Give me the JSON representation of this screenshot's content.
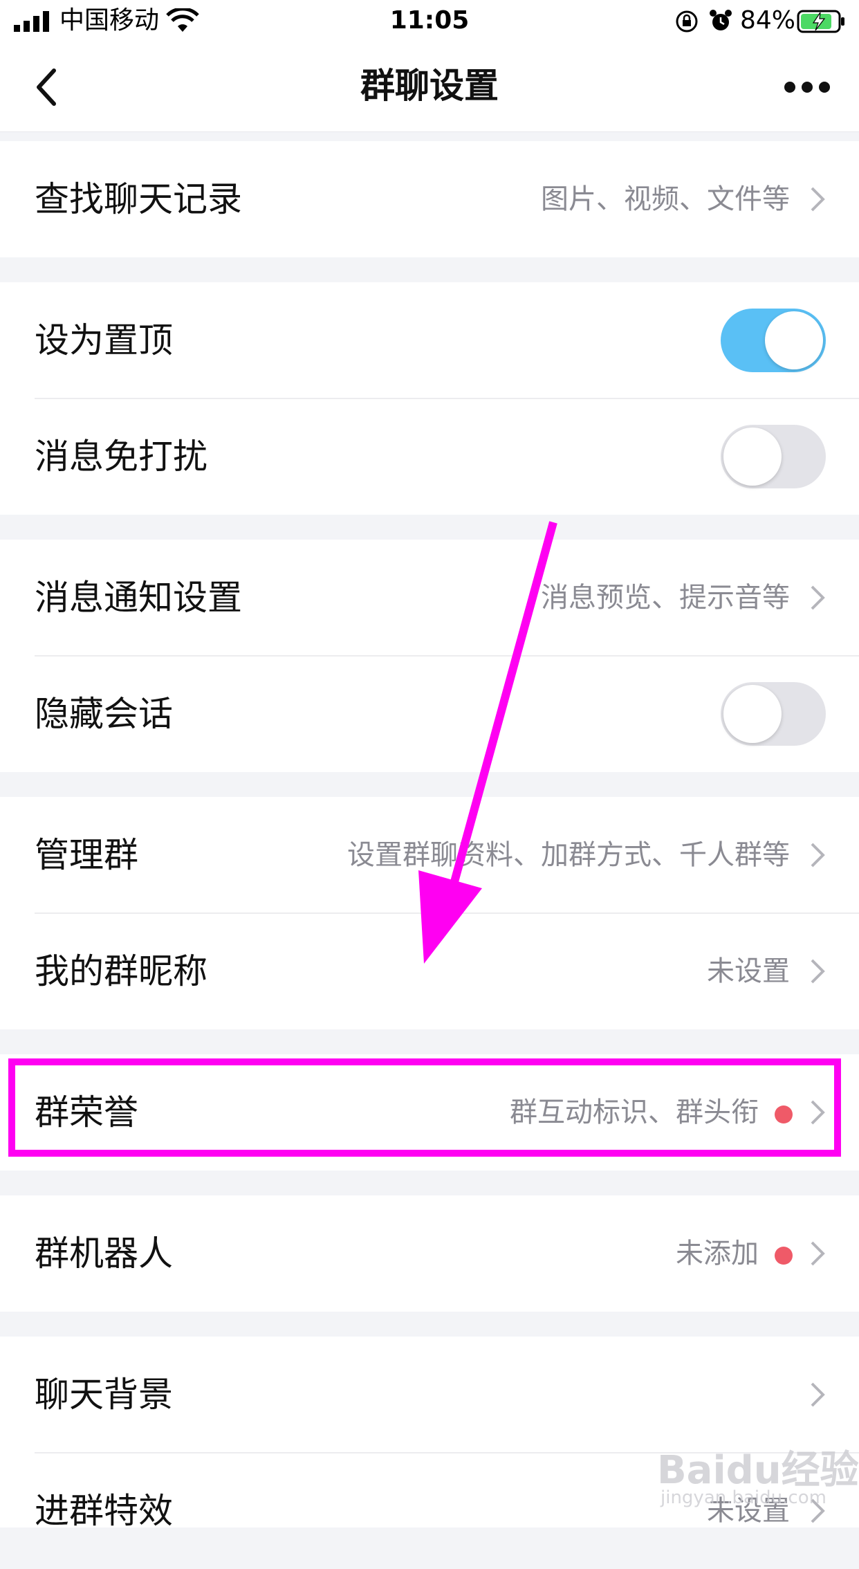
{
  "status_bar": {
    "carrier": "中国移动",
    "time": "11:05",
    "battery": "84%"
  },
  "nav": {
    "title": "群聊设置"
  },
  "rows": {
    "search": {
      "label": "查找聊天记录",
      "sub": "图片、视频、文件等"
    },
    "pin": {
      "label": "设为置顶",
      "toggle": "on"
    },
    "dnd": {
      "label": "消息免打扰",
      "toggle": "off"
    },
    "notify": {
      "label": "消息通知设置",
      "sub": "消息预览、提示音等"
    },
    "hide": {
      "label": "隐藏会话",
      "toggle": "off"
    },
    "manage": {
      "label": "管理群",
      "sub": "设置群聊资料、加群方式、千人群等"
    },
    "nickname": {
      "label": "我的群昵称",
      "sub": "未设置"
    },
    "honor": {
      "label": "群荣誉",
      "sub": "群互动标识、群头衔"
    },
    "robot": {
      "label": "群机器人",
      "sub": "未添加"
    },
    "background": {
      "label": "聊天背景"
    },
    "effect": {
      "label": "进群特效",
      "sub": "未设置"
    }
  },
  "watermark": {
    "brand": "Baidu经验",
    "url": "jingyan.baidu.com"
  },
  "colors": {
    "toggle_on": "#5ac0f5",
    "annotation": "#ff00f2",
    "badge_dot": "#ef5a68"
  }
}
